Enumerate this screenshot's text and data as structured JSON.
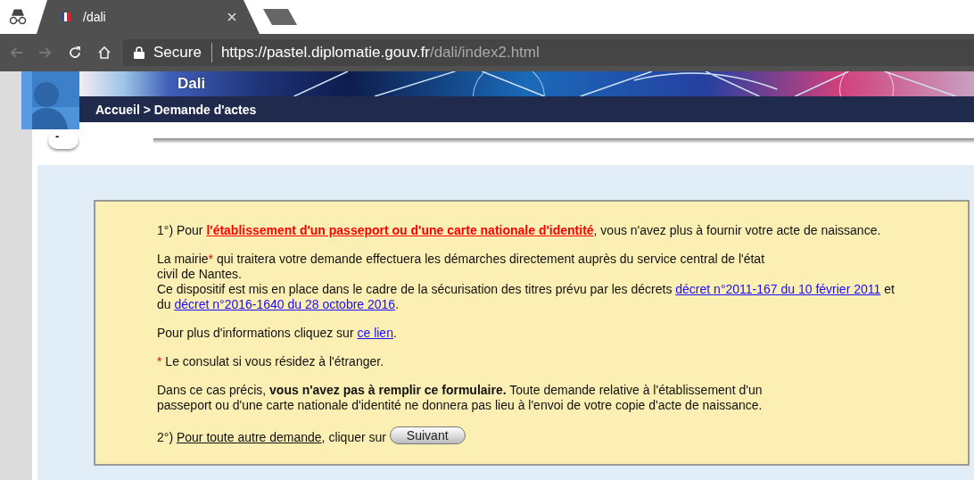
{
  "browser": {
    "tab": {
      "title": "/dali"
    },
    "nav_buttons": [
      {
        "kind": "back",
        "disabled": true
      },
      {
        "kind": "forward",
        "disabled": true
      },
      {
        "kind": "reload",
        "disabled": false
      },
      {
        "kind": "home",
        "disabled": false
      }
    ],
    "security_label": "Secure",
    "url": {
      "host": "https://pastel.diplomatie.gouv.fr",
      "path": "/dali/index2.html"
    }
  },
  "header": {
    "site_title": "Dali",
    "breadcrumb": "Accueil > Demande d'actes",
    "toggle": "-"
  },
  "notice": {
    "paragraphs": [
      {
        "lines": [
          [
            {
              "kind": "text",
              "text": "1°) Pour "
            },
            {
              "kind": "alert-link",
              "text": "l'établissement d'un passeport ou d'une carte nationale d'identité"
            },
            {
              "kind": "text",
              "text": ", vous n'avez plus à fournir votre acte de naissance."
            }
          ]
        ]
      },
      {
        "lines": [
          [
            {
              "kind": "text",
              "text": "La mairie"
            },
            {
              "kind": "mark",
              "text": "*"
            },
            {
              "kind": "text",
              "text": " qui traitera votre demande effectuera les démarches directement auprès du service central de l'état"
            }
          ],
          [
            {
              "kind": "text",
              "text": "civil de Nantes."
            }
          ],
          [
            {
              "kind": "text",
              "text": "Ce dispositif est mis en place dans le cadre de la sécurisation des titres prévu par les décrets "
            },
            {
              "kind": "link",
              "text": "décret n°2011-167 du 10 février 2011"
            },
            {
              "kind": "text",
              "text": " et"
            }
          ],
          [
            {
              "kind": "text",
              "text": "du "
            },
            {
              "kind": "link",
              "text": "décret n°2016-1640 du 28 octobre 2016"
            },
            {
              "kind": "text",
              "text": "."
            }
          ]
        ]
      },
      {
        "lines": [
          [
            {
              "kind": "text",
              "text": "Pour plus d'informations cliquez sur "
            },
            {
              "kind": "link",
              "text": "ce lien"
            },
            {
              "kind": "text",
              "text": "."
            }
          ]
        ]
      },
      {
        "lines": [
          [
            {
              "kind": "mark",
              "text": "*"
            },
            {
              "kind": "text",
              "text": " Le consulat si vous résidez à l'étranger."
            }
          ]
        ]
      },
      {
        "lines": [
          [
            {
              "kind": "text",
              "text": "Dans ce cas précis, **vous n'avez pas à remplir ce formulaire.** Toute demande relative à l'établissement d'un"
            }
          ],
          [
            {
              "kind": "text",
              "text": "passeport ou d'une carte nationale d'identité ne donnera pas lieu à l'envoi de votre copie d'acte de naissance."
            }
          ]
        ]
      },
      {
        "lines": [
          [
            {
              "kind": "text",
              "text": "2°) "
            },
            {
              "kind": "plain-link",
              "text": "Pour toute autre demande"
            },
            {
              "kind": "text",
              "text": ", cliquer sur "
            },
            {
              "kind": "button",
              "text": "Suivant"
            }
          ]
        ]
      }
    ]
  }
}
